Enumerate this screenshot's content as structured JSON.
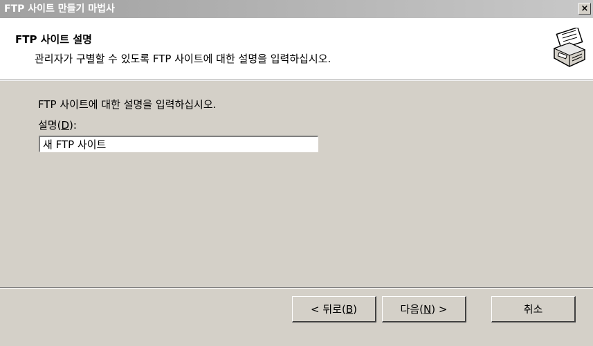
{
  "window": {
    "title": "FTP 사이트 만들기 마법사",
    "close_label": "×"
  },
  "header": {
    "title": "FTP 사이트 설명",
    "subtitle": "관리자가 구별할 수 있도록 FTP 사이트에 대한 설명을 입력하십시오.",
    "icon": "wizard-printer-icon"
  },
  "body": {
    "prompt": "FTP 사이트에 대한 설명을 입력하십시오.",
    "field_label_prefix": "설명(",
    "field_label_accel": "D",
    "field_label_suffix": "):",
    "description_value": "새 FTP 사이트"
  },
  "buttons": {
    "back": {
      "prefix": "< 뒤로(",
      "accel": "B",
      "suffix": ")"
    },
    "next": {
      "prefix": "다음(",
      "accel": "N",
      "suffix": ") >"
    },
    "cancel": "취소"
  }
}
